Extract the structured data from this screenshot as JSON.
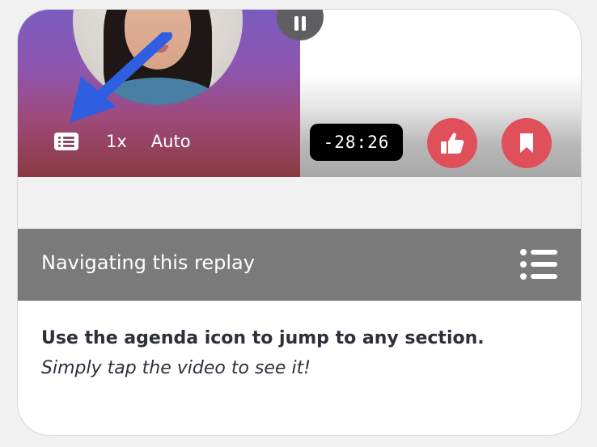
{
  "player": {
    "speed_label": "1x",
    "quality_label": "Auto",
    "time_remaining": "-28:26",
    "icons": {
      "agenda": "agenda-icon",
      "pause": "pause-icon",
      "like": "thumbs-up-icon",
      "bookmark": "bookmark-icon",
      "pointer": "pointer-arrow-icon"
    }
  },
  "tip": {
    "title": "Navigating this replay",
    "icon": "list-icon",
    "line1": "Use the agenda icon to jump to any section.",
    "line2": "Simply tap the video to see it!"
  },
  "colors": {
    "accent": "#e0505a",
    "arrow": "#2f5fe0",
    "bar_bg": "#7a7a7a",
    "text": "#2d2f3a"
  }
}
